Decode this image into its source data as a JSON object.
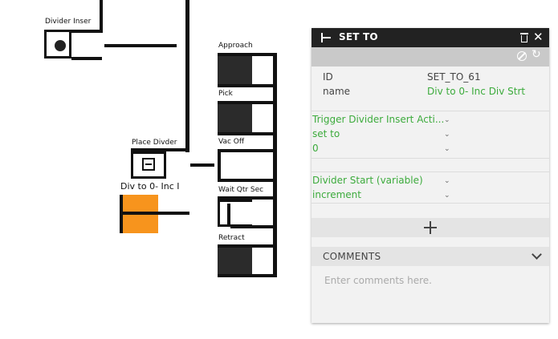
{
  "canvas": {
    "nodes": [
      {
        "label": "Divider Inser"
      },
      {
        "label": "Place Divder"
      },
      {
        "label": "Div to 0- Inc I"
      },
      {
        "label": "Approach"
      },
      {
        "label": "Pick"
      },
      {
        "label": "Vac Off"
      },
      {
        "label": "Wait Qtr Sec"
      },
      {
        "label": "Retract"
      }
    ],
    "highlight_color": "#f7941d"
  },
  "panel": {
    "title": "SET TO",
    "rows": {
      "id_key": "ID",
      "id_value": "SET_TO_61",
      "name_key": "name",
      "name_value": "Div to 0- Inc Div Strt"
    },
    "group1": {
      "target": "Trigger Divider Insert Acti...",
      "op": "set to",
      "value": "0"
    },
    "group2": {
      "target": "Divider Start (variable)",
      "op": "increment"
    },
    "comments": {
      "label": "COMMENTS",
      "placeholder": "Enter comments here."
    },
    "colors": {
      "header_bg": "#222222",
      "accent_green": "#3cab3c"
    }
  }
}
